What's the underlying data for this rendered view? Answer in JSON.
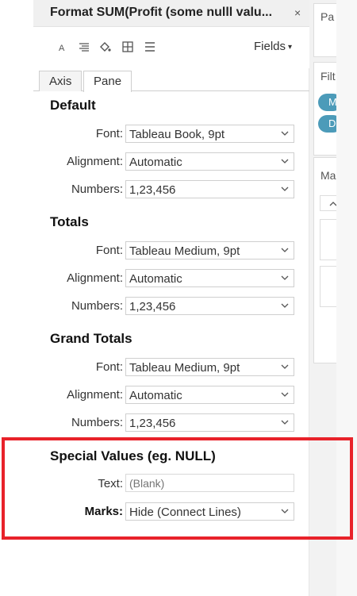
{
  "panel": {
    "title": "Format SUM(Profit (some nulll valu...",
    "close": "×",
    "fields_label": "Fields",
    "fields_caret": "▾",
    "tabs": [
      {
        "label": "Axis"
      },
      {
        "label": "Pane"
      }
    ],
    "active_tab": "Pane"
  },
  "sections": [
    {
      "title": "Default",
      "rows": [
        {
          "label": "Font:",
          "value": "Tableau Book, 9pt"
        },
        {
          "label": "Alignment:",
          "value": "Automatic"
        },
        {
          "label": "Numbers:",
          "value": "1,23,456"
        }
      ]
    },
    {
      "title": "Totals",
      "rows": [
        {
          "label": "Font:",
          "value": "Tableau Medium, 9pt"
        },
        {
          "label": "Alignment:",
          "value": "Automatic"
        },
        {
          "label": "Numbers:",
          "value": "1,23,456"
        }
      ]
    },
    {
      "title": "Grand Totals",
      "rows": [
        {
          "label": "Font:",
          "value": "Tableau Medium, 9pt"
        },
        {
          "label": "Alignment:",
          "value": "Automatic"
        },
        {
          "label": "Numbers:",
          "value": "1,23,456"
        }
      ]
    }
  ],
  "special": {
    "title": "Special Values (eg. NULL)",
    "text_label": "Text:",
    "text_placeholder": "(Blank)",
    "marks_label": "Marks:",
    "marks_value": "Hide (Connect Lines)"
  },
  "right": {
    "pages_label": "Pa",
    "filters_label": "Filt",
    "pill1": "M",
    "pill2": "D",
    "marks_label": "Ma"
  },
  "colors": {
    "highlight": "#e8222a",
    "pill": "#4c9bb9"
  }
}
